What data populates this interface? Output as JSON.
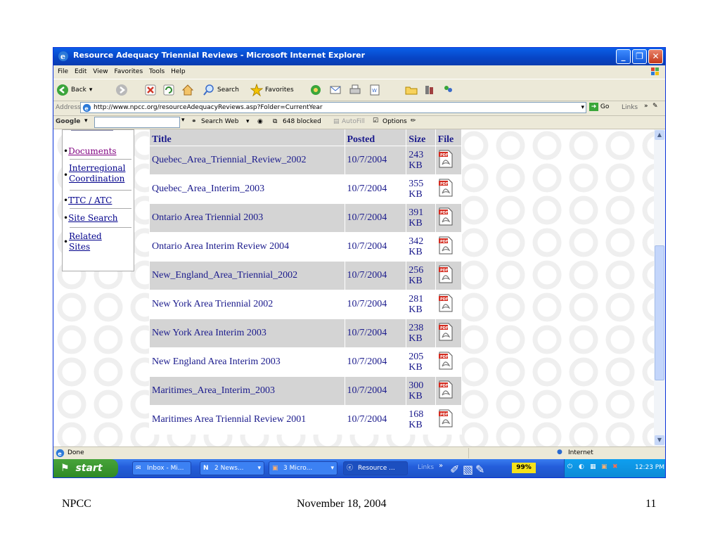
{
  "window": {
    "title": "Resource Adequacy Triennial Reviews - Microsoft Internet Explorer"
  },
  "menu": [
    "File",
    "Edit",
    "View",
    "Favorites",
    "Tools",
    "Help"
  ],
  "toolbar": {
    "back": "Back",
    "search": "Search",
    "favorites": "Favorites"
  },
  "address": {
    "label": "Address",
    "url": "http://www.npcc.org/resourceAdequacyReviews.asp?Folder=CurrentYear",
    "go": "Go",
    "links": "Links"
  },
  "google": {
    "logo": "Google",
    "search_web": "Search Web",
    "blocked": "648 blocked",
    "autofill": "AutoFill",
    "options": "Options"
  },
  "nav": {
    "items": [
      "Documents",
      "Interregional Coordination",
      "TTC / ATC",
      "Site Search",
      "Related Sites"
    ]
  },
  "table": {
    "headers": [
      "Title",
      "Posted",
      "Size",
      "File"
    ],
    "rows": [
      {
        "title": "Quebec_Area_Triennial_Review_2002",
        "posted": "10/7/2004",
        "size": "243 KB"
      },
      {
        "title": "Quebec_Area_Interim_2003",
        "posted": "10/7/2004",
        "size": "355 KB"
      },
      {
        "title": "Ontario Area Triennial 2003",
        "posted": "10/7/2004",
        "size": "391 KB"
      },
      {
        "title": "Ontario Area Interim Review 2004",
        "posted": "10/7/2004",
        "size": "342 KB"
      },
      {
        "title": "New_England_Area_Triennial_2002",
        "posted": "10/7/2004",
        "size": "256 KB"
      },
      {
        "title": "New York Area Triennial 2002",
        "posted": "10/7/2004",
        "size": "281 KB"
      },
      {
        "title": "New York Area Interim 2003",
        "posted": "10/7/2004",
        "size": "238 KB"
      },
      {
        "title": "New England Area Interim 2003",
        "posted": "10/7/2004",
        "size": "205 KB"
      },
      {
        "title": "Maritimes_Area_Interim_2003",
        "posted": "10/7/2004",
        "size": "300 KB"
      },
      {
        "title": "Maritimes Area Triennial Review 2001",
        "posted": "10/7/2004",
        "size": "168 KB"
      }
    ],
    "pdf_label": "PDF"
  },
  "status": {
    "text": "Done",
    "zone": "Internet"
  },
  "taskbar": {
    "start": "start",
    "tasks": [
      "Inbox - Mi...",
      "2 News...",
      "3 Micro...",
      "Resource ..."
    ],
    "links": "Links",
    "battery": "99%",
    "clock": "12:23 PM"
  },
  "slide_footer": {
    "left": "NPCC",
    "center": "November 18, 2004",
    "right": "11"
  },
  "colors": {
    "row_gray": "#d4d4d4",
    "row_white": "#ffffff",
    "link": "#1a1a8c"
  }
}
